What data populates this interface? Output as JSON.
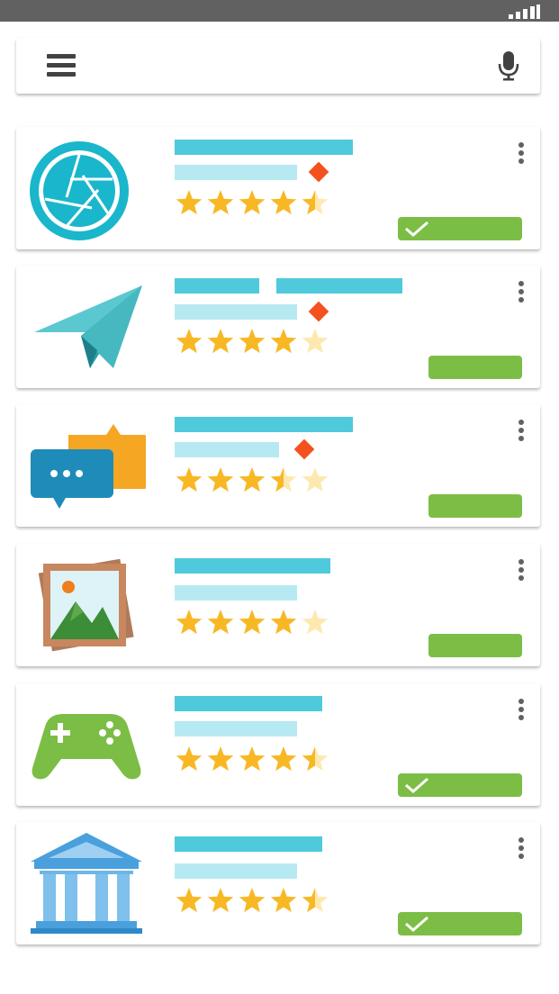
{
  "status_bar": {
    "icon": "signal-icon"
  },
  "search": {
    "menu_icon": "menu-icon",
    "voice_icon": "mic-icon"
  },
  "colors": {
    "title_bar": "#4fc9dc",
    "subtitle_bar": "#b6e9f2",
    "badge": "#f4511e",
    "star": "#f8b824",
    "star_empty": "#fde9b0",
    "install": "#7cbd46"
  },
  "apps": [
    {
      "icon": "camera-aperture-icon",
      "rating": 4.5,
      "has_badge": true,
      "installed": true
    },
    {
      "icon": "paper-plane-icon",
      "rating": 4.0,
      "has_badge": true,
      "installed": false
    },
    {
      "icon": "chat-bubbles-icon",
      "rating": 3.5,
      "has_badge": true,
      "installed": false
    },
    {
      "icon": "photo-gallery-icon",
      "rating": 4.0,
      "has_badge": false,
      "installed": false
    },
    {
      "icon": "game-controller-icon",
      "rating": 4.5,
      "has_badge": false,
      "installed": true
    },
    {
      "icon": "bank-building-icon",
      "rating": 4.5,
      "has_badge": false,
      "installed": true
    }
  ]
}
